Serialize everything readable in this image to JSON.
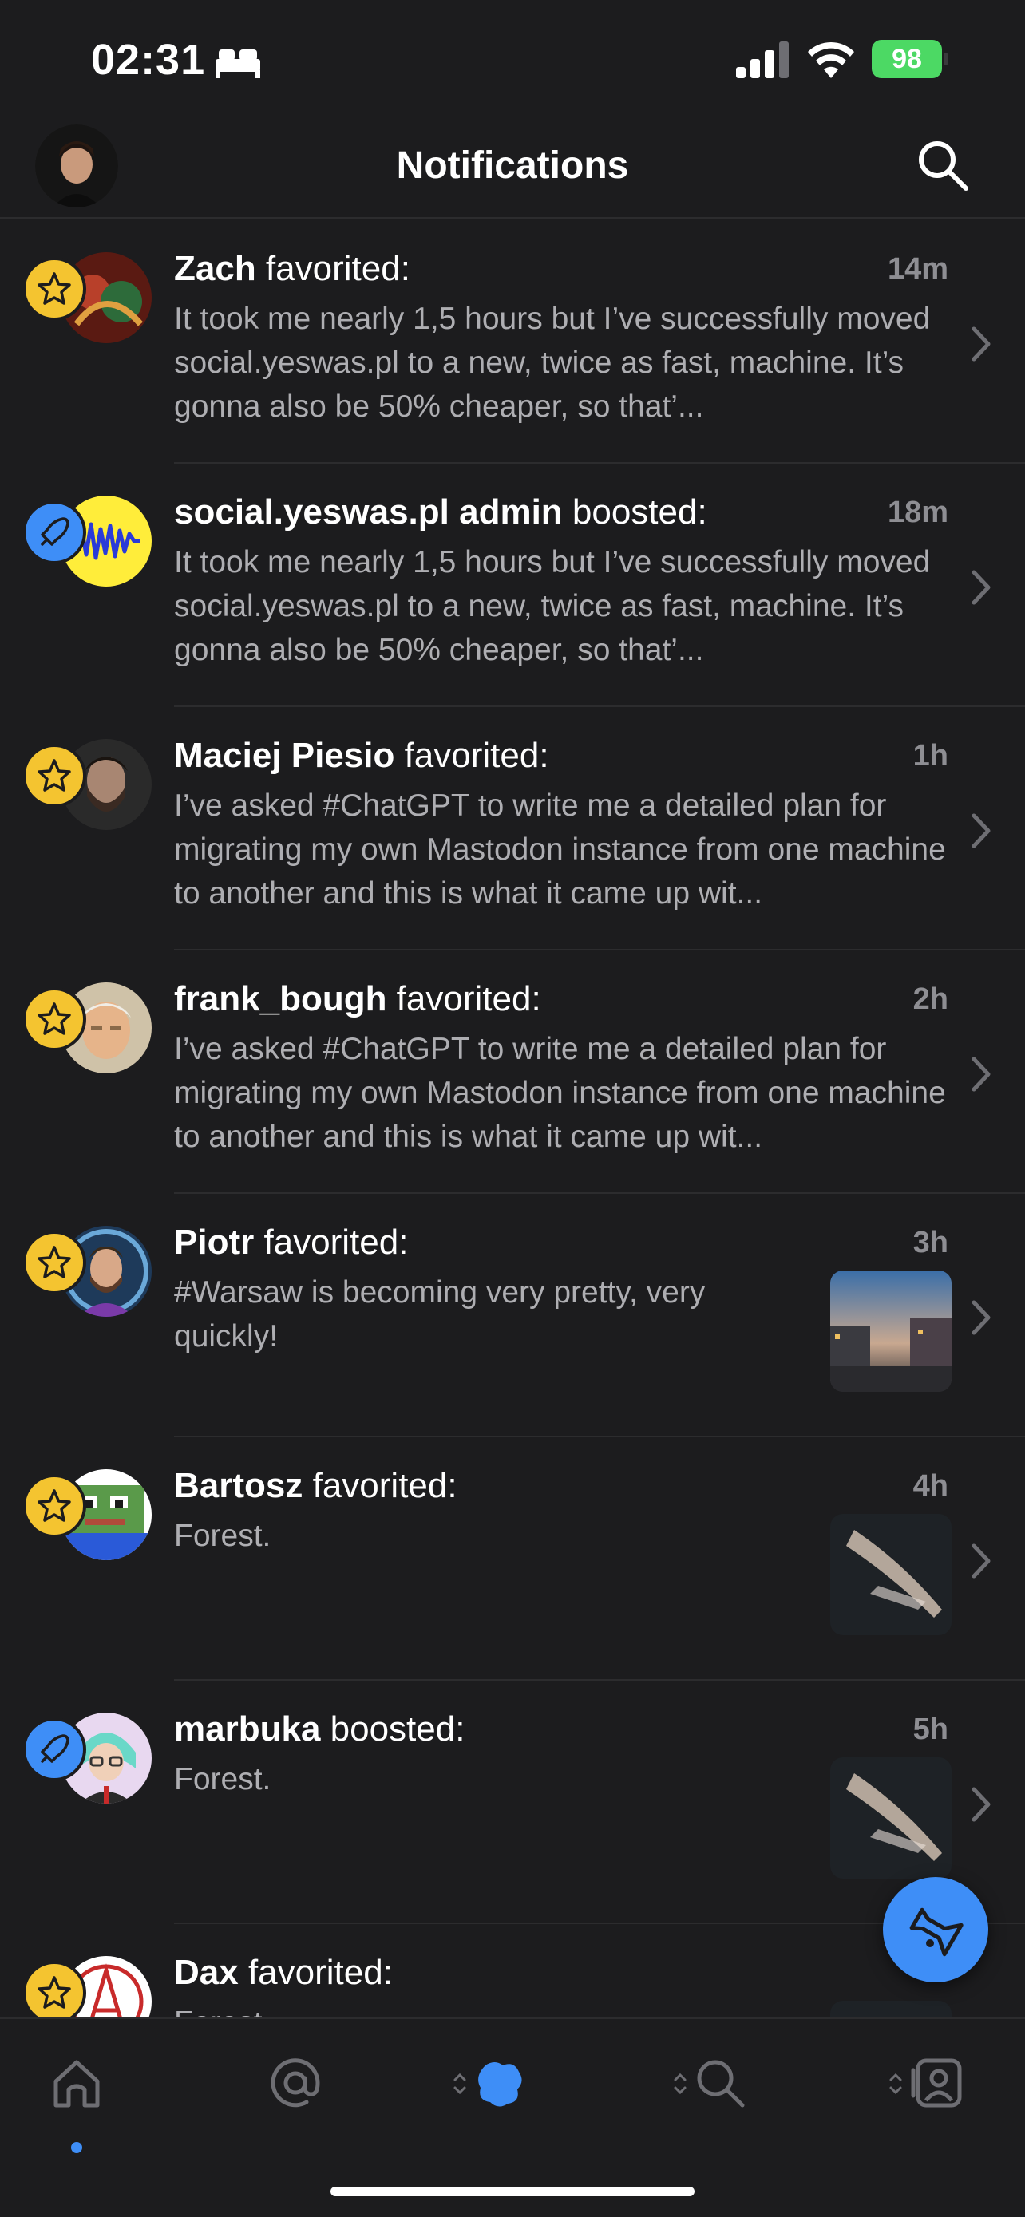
{
  "status_bar": {
    "time": "02:31",
    "battery": "98",
    "icons": [
      "bed-icon",
      "signal-icon",
      "wifi-icon",
      "battery-icon"
    ]
  },
  "header": {
    "title": "Notifications",
    "icons": [
      "profile-avatar",
      "search-icon"
    ]
  },
  "notifications": [
    {
      "type": "favorite",
      "name": "Zach",
      "action": " favorited:",
      "time": "14m",
      "text": "It took me nearly 1,5 hours but I’ve successfully moved social.yeswas.pl to a new, twice as fast, machine. It’s gonna also be 50% cheaper, so that’...",
      "has_thumb": false
    },
    {
      "type": "boost",
      "name": "social.yeswas.pl admin",
      "action": " boosted:",
      "time": "18m",
      "text": "It took me nearly 1,5 hours but I’ve successfully moved social.yeswas.pl to a new, twice as fast, machine. It’s gonna also be 50% cheaper, so that’...",
      "has_thumb": false
    },
    {
      "type": "favorite",
      "name": "Maciej Piesio",
      "action": " favorited:",
      "time": "1h",
      "text": "I’ve asked #ChatGPT to write me a detailed plan for migrating my own Mastodon instance from one machine to another and this is what it came up wit...",
      "has_thumb": false
    },
    {
      "type": "favorite",
      "name": "frank_bough",
      "action": " favorited:",
      "time": "2h",
      "text": "I’ve asked #ChatGPT to write me a detailed plan for migrating my own Mastodon instance from one machine to another and this is what it came up wit...",
      "has_thumb": false
    },
    {
      "type": "favorite",
      "name": "Piotr",
      "action": " favorited:",
      "time": "3h",
      "text": "#Warsaw is becoming very pretty, very quickly!",
      "has_thumb": true
    },
    {
      "type": "favorite",
      "name": "Bartosz",
      "action": " favorited:",
      "time": "4h",
      "text": "Forest.",
      "has_thumb": true
    },
    {
      "type": "boost",
      "name": "marbuka",
      "action": " boosted:",
      "time": "5h",
      "text": "Forest.",
      "has_thumb": true
    },
    {
      "type": "favorite",
      "name": "Dax",
      "action": " favorited:",
      "time": "",
      "text": "Forest.",
      "has_thumb": true
    }
  ],
  "fab": {
    "icon": "trumpet-compose-icon"
  },
  "tab_bar": {
    "tabs": [
      "home-icon",
      "mentions-icon",
      "notifications-icon",
      "explore-icon",
      "profile-icon"
    ],
    "active": "notifications-icon",
    "accent": "#3e8ef7"
  },
  "colors": {
    "favorite_badge": "#f4c430",
    "boost_badge": "#3e8ef7",
    "background": "#1c1c1e"
  }
}
